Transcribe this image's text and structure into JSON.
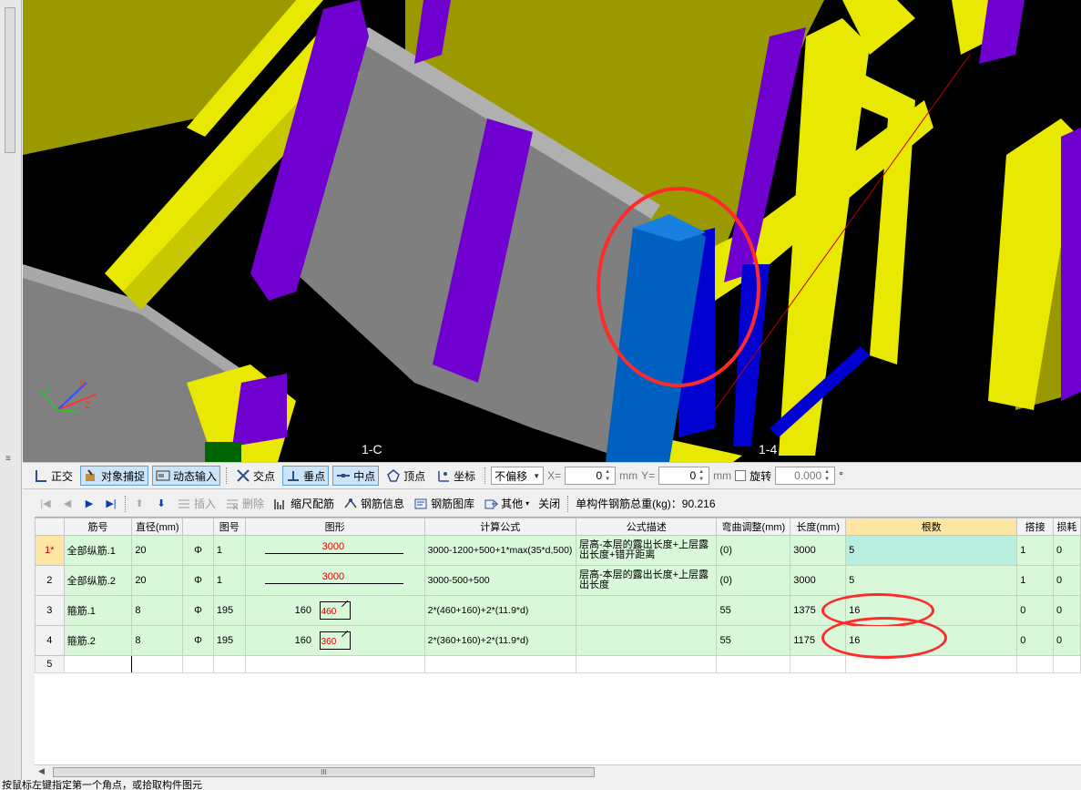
{
  "viewport": {
    "axis_labels": [
      "1-C",
      "1-4"
    ],
    "gizmo_axes": [
      "X",
      "Y",
      "Z"
    ]
  },
  "snap_toolbar": {
    "ortho": "正交",
    "object_snap": "对象捕捉",
    "dynamic_input": "动态输入",
    "intersection": "交点",
    "perpendicular": "垂点",
    "midpoint": "中点",
    "vertex": "顶点",
    "coordinate": "坐标",
    "offset_value": "不偏移",
    "x_label": "X=",
    "x_value": "0",
    "x_unit": "mm",
    "y_label": "Y=",
    "y_value": "0",
    "y_unit": "mm",
    "rotate_label": "旋转",
    "rotate_value": "0.000",
    "rotate_unit": "°"
  },
  "rebar_toolbar": {
    "insert": "插入",
    "delete": "删除",
    "scale_rebar": "缩尺配筋",
    "rebar_info": "钢筋信息",
    "rebar_library": "钢筋图库",
    "other": "其他",
    "close": "关闭",
    "total_weight_label": "单构件钢筋总重(kg)：90.216"
  },
  "grid": {
    "columns": [
      "筋号",
      "直径(mm)",
      "",
      "图号",
      "图形",
      "计算公式",
      "公式描述",
      "弯曲调整(mm)",
      "长度(mm)",
      "根数",
      "搭接",
      "损耗"
    ],
    "rows": [
      {
        "no": "1*",
        "name": "全部纵筋.1",
        "diameter": "20",
        "grade": "Φ",
        "shape_no": "1",
        "shape_left": "",
        "shape_value": "3000",
        "formula": "3000-1200+500+1*max(35*d,500)",
        "description": "层高-本层的露出长度+上层露出长度+错开距离",
        "bend": "(0)",
        "length": "3000",
        "count": "5",
        "lap": "1",
        "loss": "0"
      },
      {
        "no": "2",
        "name": "全部纵筋.2",
        "diameter": "20",
        "grade": "Φ",
        "shape_no": "1",
        "shape_left": "",
        "shape_value": "3000",
        "formula": "3000-500+500",
        "description": "层高-本层的露出长度+上层露出长度",
        "bend": "(0)",
        "length": "3000",
        "count": "5",
        "lap": "1",
        "loss": "0"
      },
      {
        "no": "3",
        "name": "箍筋.1",
        "diameter": "8",
        "grade": "Φ",
        "shape_no": "195",
        "shape_left": "160",
        "shape_value": "460",
        "formula": "2*(460+160)+2*(11.9*d)",
        "description": "",
        "bend": "55",
        "length": "1375",
        "count": "16",
        "lap": "0",
        "loss": "0"
      },
      {
        "no": "4",
        "name": "箍筋.2",
        "diameter": "8",
        "grade": "Φ",
        "shape_no": "195",
        "shape_left": "160",
        "shape_value": "360",
        "formula": "2*(360+160)+2*(11.9*d)",
        "description": "",
        "bend": "55",
        "length": "1175",
        "count": "16",
        "lap": "0",
        "loss": "0"
      }
    ],
    "blank_row_no": "5"
  },
  "scrollbar": {
    "grip": "III"
  },
  "status": {
    "text": "按鼠标左键指定第一个角点，或拾取构件图元"
  },
  "colors": {
    "beam_yellow": "#e8e800",
    "wall_olive": "#9a9a00",
    "column_purple": "#7000d0",
    "slab_gray": "#7f7f7f",
    "highlight_blue": "#0060c0",
    "annotation_red": "#ff2a2a",
    "row_green": "#d9f7d9",
    "header_highlight": "#fde6a4"
  }
}
